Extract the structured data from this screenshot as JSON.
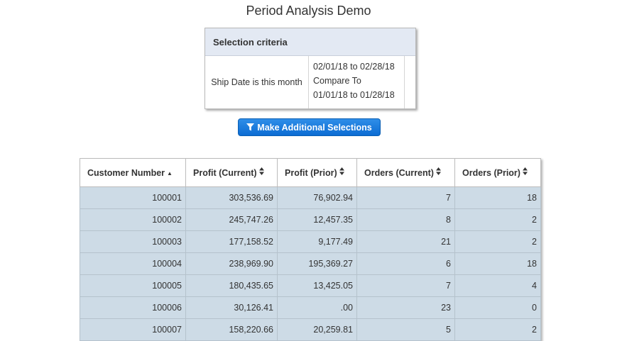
{
  "page": {
    "title": "Period Analysis Demo"
  },
  "criteria": {
    "header": "Selection criteria",
    "label": "Ship Date is this month",
    "value_lines": [
      "02/01/18 to 02/28/18",
      "Compare To",
      "01/01/18 to 01/28/18"
    ]
  },
  "button": {
    "label": "Make Additional Selections",
    "icon": "filter-icon"
  },
  "table": {
    "columns": [
      {
        "label": "Customer Number",
        "sort": "ascending"
      },
      {
        "label": "Profit (Current)",
        "sort": "unsorted"
      },
      {
        "label": "Profit (Prior)",
        "sort": "unsorted"
      },
      {
        "label": "Orders (Current)",
        "sort": "unsorted"
      },
      {
        "label": "Orders (Prior)",
        "sort": "unsorted"
      }
    ],
    "rows": [
      [
        "100001",
        "303,536.69",
        "76,902.94",
        "7",
        "18"
      ],
      [
        "100002",
        "245,747.26",
        "12,457.35",
        "8",
        "2"
      ],
      [
        "100003",
        "177,158.52",
        "9,177.49",
        "21",
        "2"
      ],
      [
        "100004",
        "238,969.90",
        "195,369.27",
        "6",
        "18"
      ],
      [
        "100005",
        "180,435.65",
        "13,425.05",
        "7",
        "4"
      ],
      [
        "100006",
        "30,126.41",
        ".00",
        "23",
        "0"
      ],
      [
        "100007",
        "158,220.66",
        "20,259.81",
        "5",
        "2"
      ]
    ]
  },
  "colors": {
    "header_band": "#e3e9f3",
    "row_background": "#cddbe6",
    "button_accent": "#1a7ddf"
  }
}
